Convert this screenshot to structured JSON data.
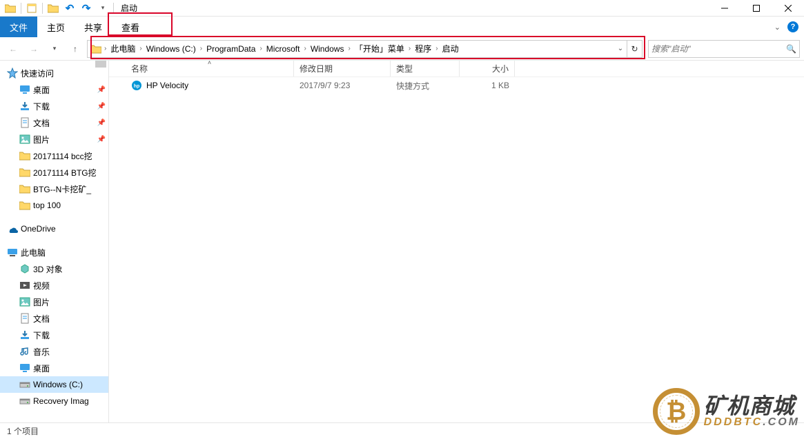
{
  "window": {
    "title": "启动"
  },
  "ribbon": {
    "file": "文件",
    "tabs": [
      "主页",
      "共享",
      "查看"
    ]
  },
  "breadcrumbs": [
    "此电脑",
    "Windows (C:)",
    "ProgramData",
    "Microsoft",
    "Windows",
    "「开始」菜单",
    "程序",
    "启动"
  ],
  "search": {
    "placeholder": "搜索\"启动\""
  },
  "sidebar": {
    "quick": {
      "label": "快速访问",
      "items": [
        {
          "label": "桌面",
          "pinned": true,
          "icon": "desktop"
        },
        {
          "label": "下载",
          "pinned": true,
          "icon": "download"
        },
        {
          "label": "文档",
          "pinned": true,
          "icon": "document"
        },
        {
          "label": "图片",
          "pinned": true,
          "icon": "pictures"
        },
        {
          "label": "20171114 bcc挖",
          "pinned": false,
          "icon": "folder"
        },
        {
          "label": "20171114 BTG挖",
          "pinned": false,
          "icon": "folder"
        },
        {
          "label": "BTG--N卡挖矿_",
          "pinned": false,
          "icon": "folder"
        },
        {
          "label": "top 100",
          "pinned": false,
          "icon": "folder"
        }
      ]
    },
    "onedrive": {
      "label": "OneDrive"
    },
    "thispc": {
      "label": "此电脑",
      "items": [
        {
          "label": "3D 对象",
          "icon": "3d"
        },
        {
          "label": "视频",
          "icon": "video"
        },
        {
          "label": "图片",
          "icon": "pictures"
        },
        {
          "label": "文档",
          "icon": "document"
        },
        {
          "label": "下载",
          "icon": "download"
        },
        {
          "label": "音乐",
          "icon": "music"
        },
        {
          "label": "桌面",
          "icon": "desktop"
        },
        {
          "label": "Windows (C:)",
          "icon": "drive",
          "selected": true
        },
        {
          "label": "Recovery Imag",
          "icon": "drive"
        }
      ]
    }
  },
  "columns": {
    "name": "名称",
    "date": "修改日期",
    "type": "类型",
    "size": "大小"
  },
  "files": [
    {
      "name": "HP Velocity",
      "date": "2017/9/7 9:23",
      "type": "快捷方式",
      "size": "1 KB"
    }
  ],
  "status": {
    "count": "1 个项目"
  },
  "highlight": {
    "tab_index": 2
  },
  "watermark": {
    "line1": "矿机商城",
    "line2a": "DDDBTC",
    "line2b": ".COM"
  }
}
